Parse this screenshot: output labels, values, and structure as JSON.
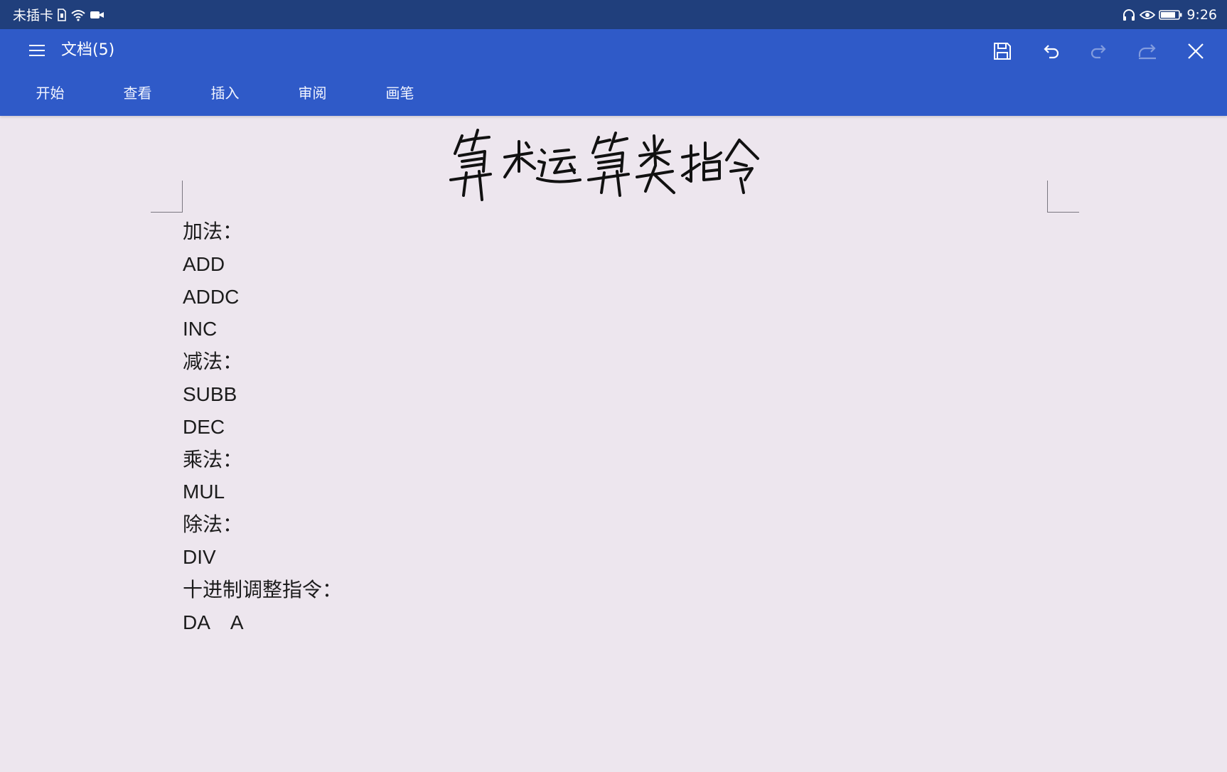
{
  "status_bar": {
    "sim_text": "未插卡",
    "time": "9:26"
  },
  "app": {
    "doc_title": "文档(5)",
    "tabs": [
      {
        "label": "开始"
      },
      {
        "label": "查看"
      },
      {
        "label": "插入"
      },
      {
        "label": "审阅"
      },
      {
        "label": "画笔"
      }
    ]
  },
  "document": {
    "handwritten_title": "算术运算类指令",
    "lines": [
      "加法：",
      "ADD",
      "ADDC",
      "INC",
      "减法：",
      "SUBB",
      "DEC",
      "乘法：",
      "MUL",
      "除法：",
      "DIV",
      "十进制调整指令：",
      "DA    A"
    ]
  },
  "colors": {
    "status_bar_bg": "#203f7c",
    "app_bar_bg": "#2f5ac8",
    "page_bg": "#ede6ee",
    "text": "#1c1c1c"
  }
}
